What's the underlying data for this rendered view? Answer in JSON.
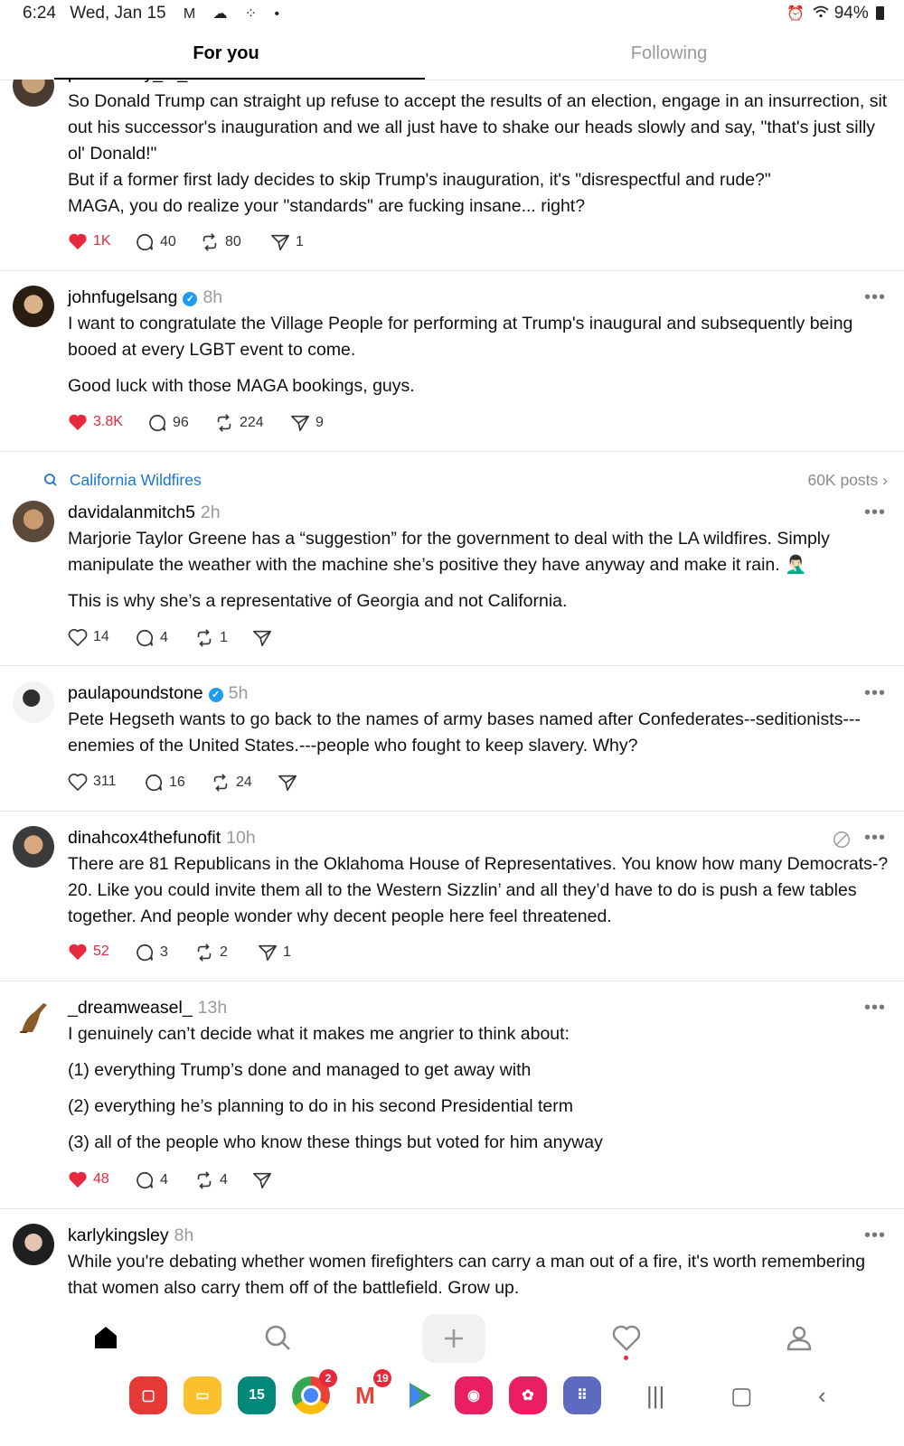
{
  "status_bar": {
    "time": "6:24",
    "date": "Wed, Jan 15",
    "battery": "94%"
  },
  "tabs": [
    {
      "label": "For you",
      "active": true
    },
    {
      "label": "Following",
      "active": false
    }
  ],
  "posts": [
    {
      "username": "personality_of_cult",
      "time": "",
      "verified": false,
      "paragraphs": [
        "So Donald Trump can straight up refuse to accept the results of an election, engage in an insurrection, sit out his successor's inauguration and we all just have to shake our heads slowly and say, \"that's just silly ol' Donald!\"\nBut if a former first lady decides to skip Trump's inauguration, it's \"disrespectful and rude?\"\nMAGA, you do realize your \"standards\" are fucking insane... right?"
      ],
      "likes": "1K",
      "liked": true,
      "replies": "40",
      "reposts": "80",
      "shares": "1"
    },
    {
      "username": "johnfugelsang",
      "time": "8h",
      "verified": true,
      "paragraphs": [
        "I want to congratulate the Village People for performing at Trump's inaugural and subsequently being booed at every LGBT event to come.",
        "Good luck with those MAGA bookings, guys."
      ],
      "likes": "3.8K",
      "liked": true,
      "replies": "96",
      "reposts": "224",
      "shares": "9"
    },
    {
      "username": "davidalanmitch5",
      "time": "2h",
      "verified": false,
      "paragraphs": [
        "Marjorie Taylor Greene has a “suggestion” for the government to deal with the LA wildfires.  Simply manipulate the weather with the machine she’s positive they have anyway and make it rain. 🤦🏻‍♂️",
        "This is why she’s a representative of Georgia and not California."
      ],
      "likes": "14",
      "liked": false,
      "replies": "4",
      "reposts": "1",
      "shares": ""
    },
    {
      "username": "paulapoundstone",
      "time": "5h",
      "verified": true,
      "paragraphs": [
        "Pete Hegseth wants to go back to the names of army bases named after Confederates--seditionists---enemies of the United States.---people who fought to keep slavery. Why?"
      ],
      "likes": "311",
      "liked": false,
      "replies": "16",
      "reposts": "24",
      "shares": ""
    },
    {
      "username": "dinahcox4thefunofit",
      "time": "10h",
      "verified": false,
      "paragraphs": [
        "There are 81 Republicans in the  Oklahoma House of Representatives. You know how many Democrats-? 20. Like you could invite them all to the Western Sizzlin’ and all they’d have to do is push a few tables together. And people wonder why decent people here feel threatened."
      ],
      "likes": "52",
      "liked": true,
      "replies": "3",
      "reposts": "2",
      "shares": "1"
    },
    {
      "username": "_dreamweasel_",
      "time": "13h",
      "verified": false,
      "paragraphs": [
        "I genuinely can’t decide what it makes me angrier to think about:",
        "(1) everything Trump’s done and managed to get away with",
        "(2) everything he’s planning to do in his second Presidential term",
        "(3) all of the people who know these things but voted for him anyway"
      ],
      "likes": "48",
      "liked": true,
      "replies": "4",
      "reposts": "4",
      "shares": ""
    },
    {
      "username": "karlykingsley",
      "time": "8h",
      "verified": false,
      "paragraphs": [
        "While you're debating whether women firefighters can carry a man out of a fire, it's worth remembering that women also carry them off of the battlefield. Grow up."
      ]
    }
  ],
  "topic": {
    "label": "California Wildfires",
    "count": "60K posts"
  },
  "dock": {
    "calendar_day": "15",
    "chrome_badge": "2",
    "gmail_badge": "19"
  }
}
